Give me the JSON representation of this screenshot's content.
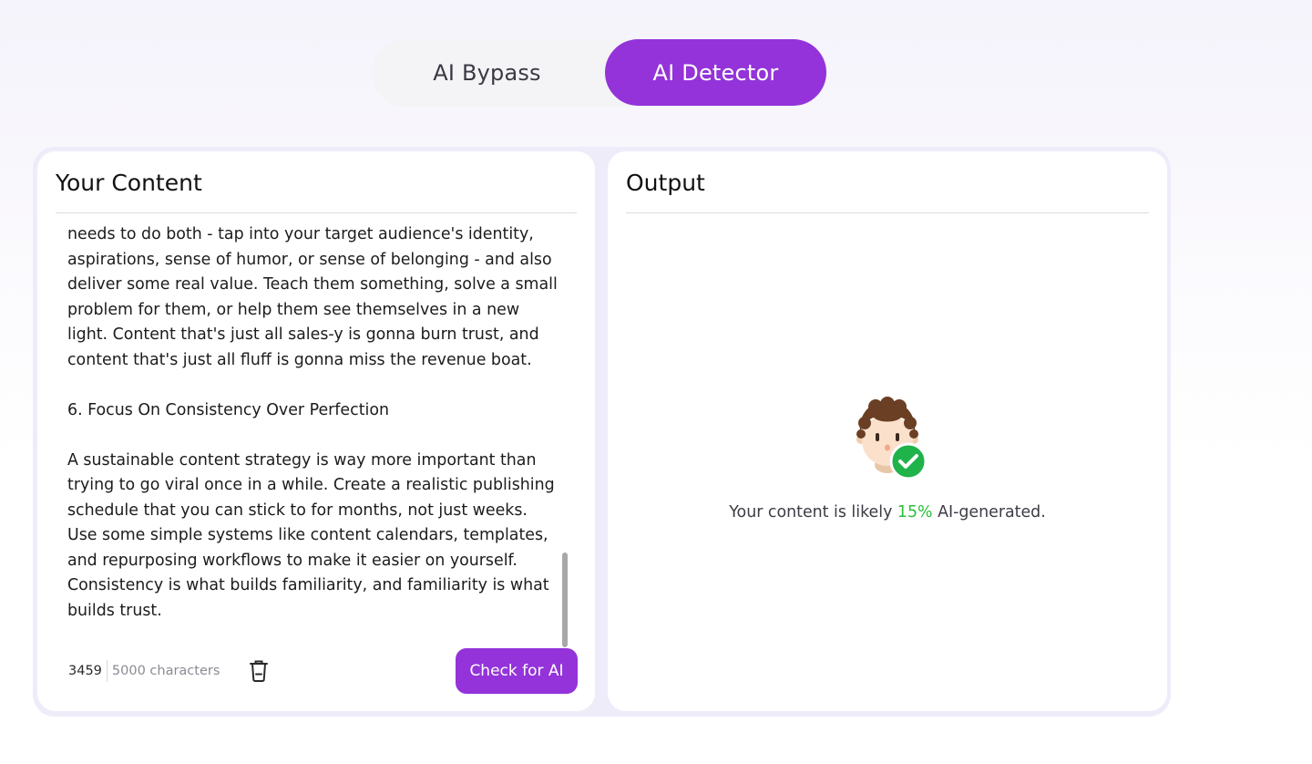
{
  "tabs": {
    "bypass_label": "AI Bypass",
    "detector_label": "AI Detector",
    "active": "AI Detector"
  },
  "input_panel": {
    "title": "Your Content",
    "text": "needs to do both - tap into your target audience's identity, aspirations, sense of humor, or sense of belonging - and also deliver some real value. Teach them something, solve a small problem for them, or help them see themselves in a new light. Content that's just all sales-y is gonna burn trust, and content that's just all fluff is gonna miss the revenue boat.\n\n6. Focus On Consistency Over Perfection\n\nA sustainable content strategy is way more important than trying to go viral once in a while. Create a realistic publishing schedule that you can stick to for months, not just weeks. Use some simple systems like content calendars, templates, and repurposing workflows to make it easier on yourself. Consistency is what builds familiarity, and familiarity is what builds trust.",
    "char_count": "3459",
    "char_limit": "5000 characters",
    "check_button": "Check for AI",
    "icons": {
      "clear": "trash-icon"
    }
  },
  "output_panel": {
    "title": "Output",
    "result_prefix": "Your content is likely ",
    "result_percent": "15%",
    "result_suffix": " AI-generated.",
    "icons": {
      "avatar": "human-avatar-icon",
      "check": "checkmark-icon"
    }
  },
  "colors": {
    "accent": "#9333d9",
    "success": "#2bbf3a",
    "panel_border": "#efecfa"
  }
}
